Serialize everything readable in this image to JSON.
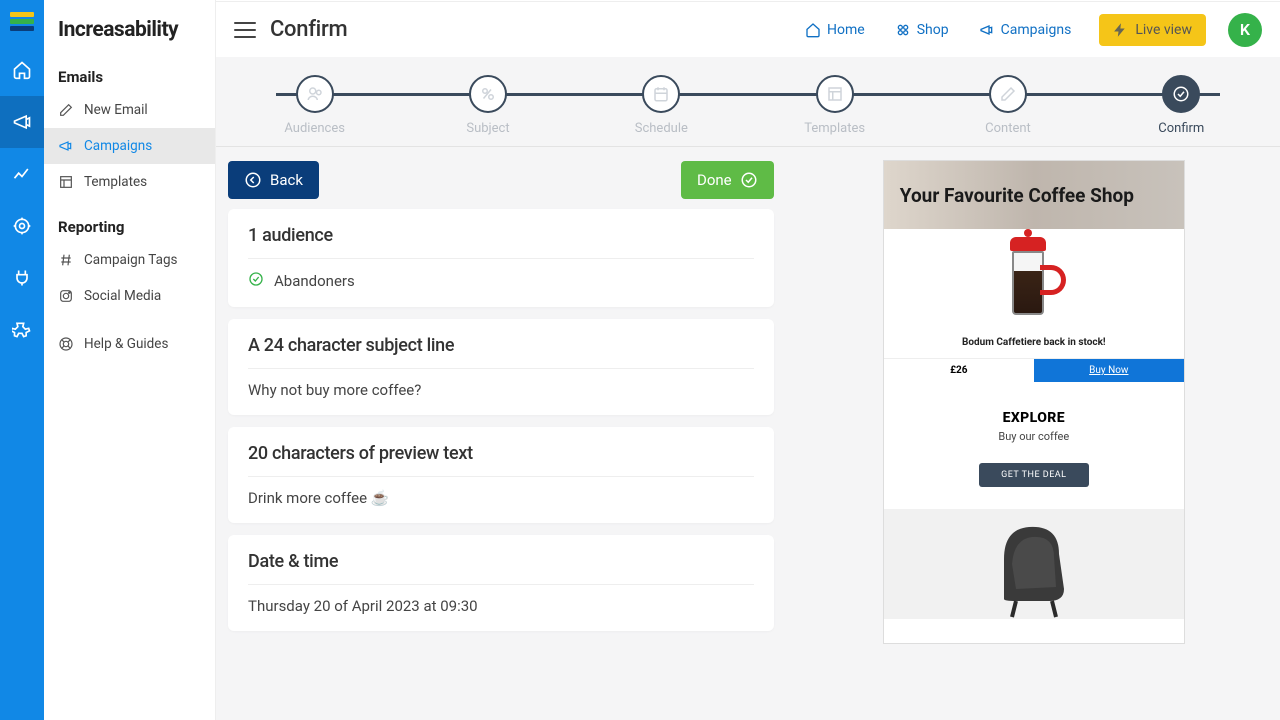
{
  "brand": "Increasability",
  "page": {
    "title": "Confirm"
  },
  "topnav": {
    "home": "Home",
    "shop": "Shop",
    "campaigns": "Campaigns",
    "live_view": "Live view",
    "avatar_initial": "K"
  },
  "sidebar": {
    "section_emails": "Emails",
    "section_reporting": "Reporting",
    "items": {
      "new_email": "New Email",
      "campaigns": "Campaigns",
      "templates": "Templates",
      "campaign_tags": "Campaign Tags",
      "social_media": "Social Media",
      "help_guides": "Help & Guides"
    }
  },
  "steps": {
    "audiences": "Audiences",
    "subject": "Subject",
    "schedule": "Schedule",
    "templates": "Templates",
    "content": "Content",
    "confirm": "Confirm"
  },
  "actions": {
    "back": "Back",
    "done": "Done"
  },
  "summary": {
    "audience_title": "1 audience",
    "audience_value": "Abandoners",
    "subject_title": "A 24 character subject line",
    "subject_value": "Why not buy more coffee?",
    "preview_title": "20 characters of preview text",
    "preview_value": "Drink more coffee ☕",
    "datetime_title": "Date & time",
    "datetime_value": "Thursday 20 of April 2023 at 09:30"
  },
  "email_preview": {
    "header": "Your Favourite Coffee Shop",
    "product_caption": "Bodum Caffetiere back in stock!",
    "price": "£26",
    "buy_now": "Buy Now",
    "explore": "EXPLORE",
    "subline": "Buy our coffee",
    "deal_button": "GET THE DEAL"
  }
}
